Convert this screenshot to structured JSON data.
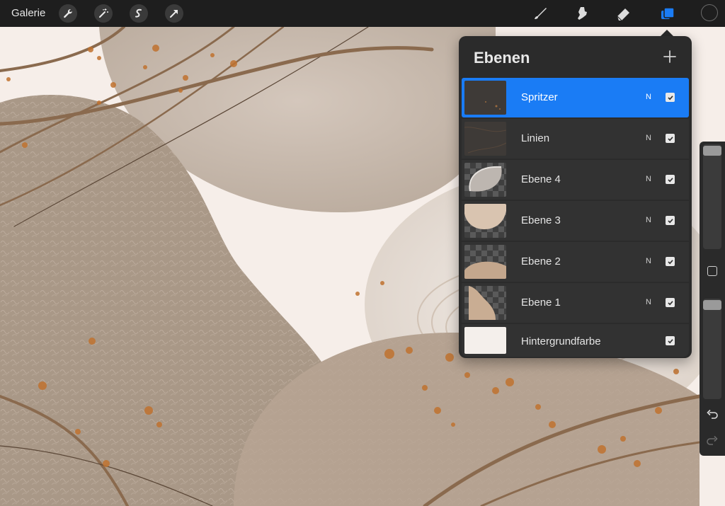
{
  "toolbar": {
    "gallery_label": "Galerie",
    "left_tools": [
      "wrench-icon",
      "magic-wand-icon",
      "selection-icon",
      "move-arrow-icon"
    ],
    "right_tools": [
      "brush-icon",
      "smudge-icon",
      "eraser-icon",
      "layers-icon"
    ],
    "active_tool": "layers-icon",
    "accent_color": "#1a7cf5",
    "current_color": "#1e1e1e"
  },
  "layers_panel": {
    "title": "Ebenen",
    "add_icon": "plus-icon",
    "layers": [
      {
        "name": "Spritzer",
        "blend": "N",
        "visible": true,
        "selected": true
      },
      {
        "name": "Linien",
        "blend": "N",
        "visible": true,
        "selected": false
      },
      {
        "name": "Ebene 4",
        "blend": "N",
        "visible": true,
        "selected": false
      },
      {
        "name": "Ebene 3",
        "blend": "N",
        "visible": true,
        "selected": false
      },
      {
        "name": "Ebene 2",
        "blend": "N",
        "visible": true,
        "selected": false
      },
      {
        "name": "Ebene 1",
        "blend": "N",
        "visible": true,
        "selected": false
      },
      {
        "name": "Hintergrundfarbe",
        "blend": "",
        "visible": true,
        "selected": false
      }
    ]
  },
  "sidebar": {
    "brush_size_level": 0.0,
    "opacity_level": 0.0,
    "buttons": [
      "modify-icon",
      "undo-icon",
      "redo-icon"
    ]
  },
  "canvas": {
    "background_color": "#f6eee9",
    "shape_colors": [
      "#a59587",
      "#c9b8aa",
      "#b3a191",
      "#e6dbd3"
    ],
    "line_color": "#8a6a4e",
    "splatter_color": "#c0722f"
  }
}
